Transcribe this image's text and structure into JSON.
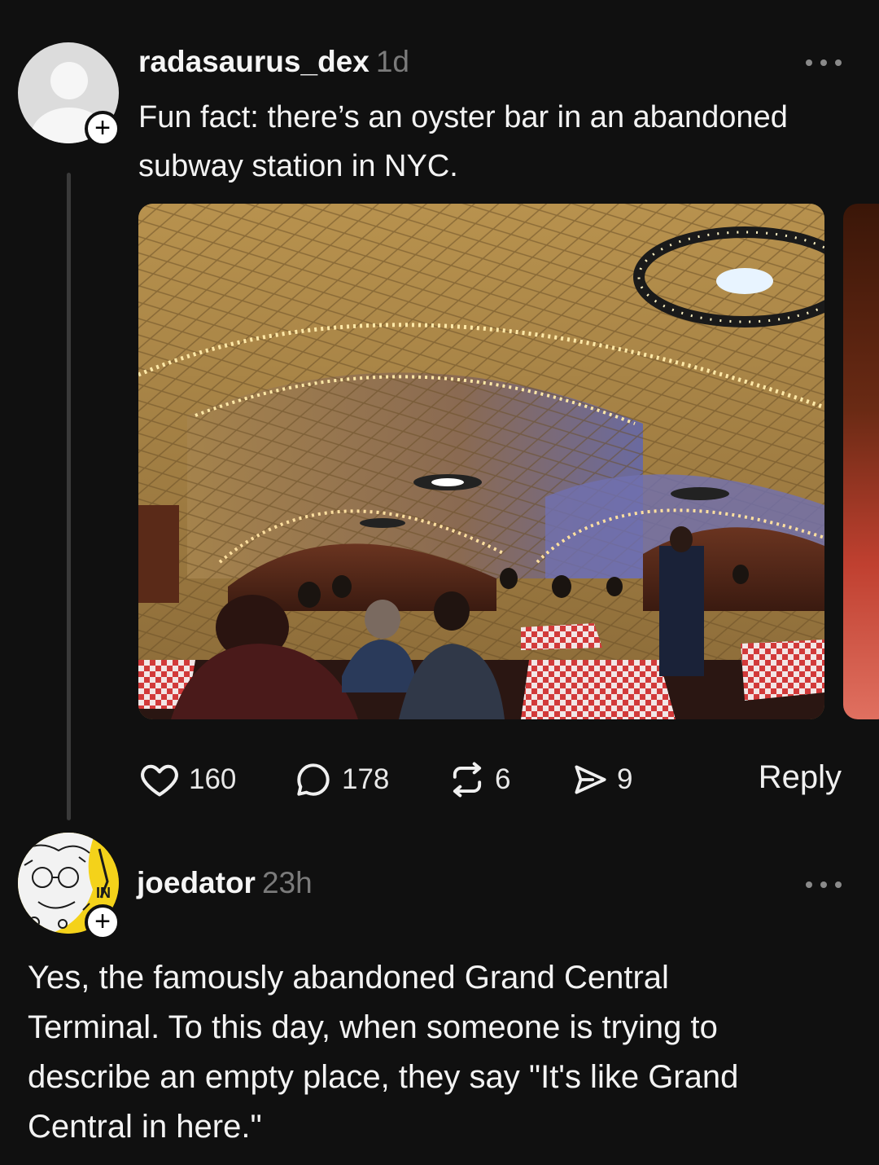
{
  "post": {
    "username": "radasaurus_dex",
    "time": "1d",
    "text_line1": "Fun fact: there’s an oyster bar in an abandoned",
    "text_line2": "subway station in NYC.",
    "avatar_icon": "default-user-avatar",
    "follow_icon": "plus-icon",
    "more_icon": "more-horizontal-icon",
    "actions": {
      "likes": "160",
      "comments": "178",
      "reposts": "6",
      "shares": "9",
      "reply_label": "Reply"
    }
  },
  "comment": {
    "username": "joedator",
    "time": "23h",
    "avatar_badge": "IN",
    "text_line1": "Yes, the famously abandoned Grand Central",
    "text_line2": "Terminal. To this day, when someone is trying to",
    "text_line3": "describe an empty place, they say \"It's like Grand",
    "text_line4": "Central in here.\""
  },
  "colors": {
    "background": "#101010",
    "secondary_text": "#7b7b7b",
    "avatar2_bg": "#f4d21a"
  }
}
